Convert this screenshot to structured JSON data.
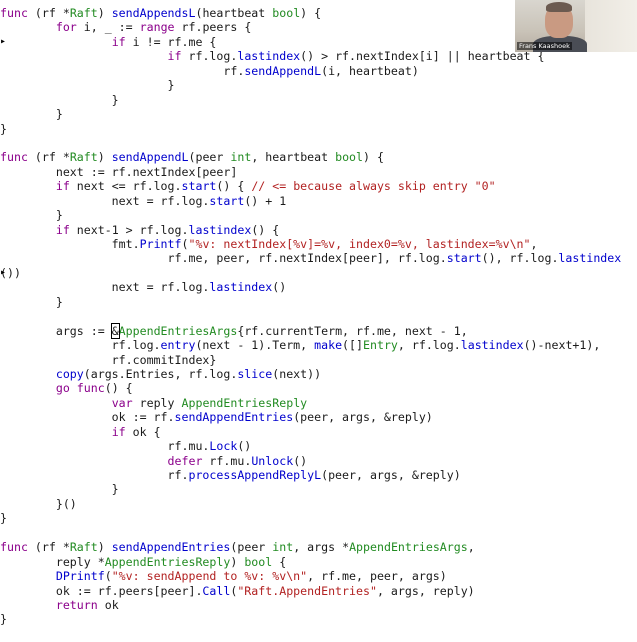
{
  "webcam": {
    "participant_name": "Frans Kaashoek"
  },
  "code_lines": [
    [
      [
        "kw",
        "func"
      ],
      [
        "id",
        " (rf *"
      ],
      [
        "ty",
        "Raft"
      ],
      [
        "id",
        ") "
      ],
      [
        "fn",
        "sendAppendsL"
      ],
      [
        "id",
        "(heartbeat "
      ],
      [
        "ty",
        "bool"
      ],
      [
        "id",
        ") {"
      ]
    ],
    [
      [
        "id",
        "        "
      ],
      [
        "kw",
        "for"
      ],
      [
        "id",
        " i, _ := "
      ],
      [
        "kw",
        "range"
      ],
      [
        "id",
        " rf.peers {"
      ]
    ],
    [
      [
        "id",
        "                "
      ],
      [
        "kw",
        "if"
      ],
      [
        "id",
        " i != rf.me {"
      ]
    ],
    [
      [
        "id",
        "                        "
      ],
      [
        "kw",
        "if"
      ],
      [
        "id",
        " rf.log."
      ],
      [
        "fn",
        "lastindex"
      ],
      [
        "id",
        "() > rf.nextIndex[i] || heartbeat {"
      ]
    ],
    [
      [
        "id",
        "                                rf."
      ],
      [
        "fn",
        "sendAppendL"
      ],
      [
        "id",
        "(i, heartbeat)"
      ]
    ],
    [
      [
        "id",
        "                        }"
      ]
    ],
    [
      [
        "id",
        "                }"
      ]
    ],
    [
      [
        "id",
        "        }"
      ]
    ],
    [
      [
        "id",
        "}"
      ]
    ],
    [
      [
        "id",
        ""
      ]
    ],
    [
      [
        "kw",
        "func"
      ],
      [
        "id",
        " (rf *"
      ],
      [
        "ty",
        "Raft"
      ],
      [
        "id",
        ") "
      ],
      [
        "fn",
        "sendAppendL"
      ],
      [
        "id",
        "(peer "
      ],
      [
        "ty",
        "int"
      ],
      [
        "id",
        ", heartbeat "
      ],
      [
        "ty",
        "bool"
      ],
      [
        "id",
        ") {"
      ]
    ],
    [
      [
        "id",
        "        next := rf.nextIndex[peer]"
      ]
    ],
    [
      [
        "id",
        "        "
      ],
      [
        "kw",
        "if"
      ],
      [
        "id",
        " next <= rf.log."
      ],
      [
        "fn",
        "start"
      ],
      [
        "id",
        "() { "
      ],
      [
        "cm",
        "// <= because always skip entry \"0\""
      ]
    ],
    [
      [
        "id",
        "                next = rf.log."
      ],
      [
        "fn",
        "start"
      ],
      [
        "id",
        "() + 1"
      ]
    ],
    [
      [
        "id",
        "        }"
      ]
    ],
    [
      [
        "id",
        "        "
      ],
      [
        "kw",
        "if"
      ],
      [
        "id",
        " next-1 > rf.log."
      ],
      [
        "fn",
        "lastindex"
      ],
      [
        "id",
        "() {"
      ]
    ],
    [
      [
        "id",
        "                fmt."
      ],
      [
        "fn",
        "Printf"
      ],
      [
        "id",
        "("
      ],
      [
        "st",
        "\"%v: nextIndex[%v]=%v, index0=%v, lastindex=%v\\n\""
      ],
      [
        "id",
        ","
      ]
    ],
    [
      [
        "id",
        "                        rf.me, peer, rf.nextIndex[peer], rf.log."
      ],
      [
        "fn",
        "start"
      ],
      [
        "id",
        "(), rf.log."
      ],
      [
        "fn",
        "lastindex"
      ]
    ],
    [
      [
        "id",
        "())"
      ]
    ],
    [
      [
        "id",
        "                next = rf.log."
      ],
      [
        "fn",
        "lastindex"
      ],
      [
        "id",
        "()"
      ]
    ],
    [
      [
        "id",
        "        }"
      ]
    ],
    [
      [
        "id",
        ""
      ]
    ],
    [
      [
        "id",
        "        args := "
      ],
      [
        "cur",
        "&"
      ],
      [
        "ty",
        "AppendEntriesArgs"
      ],
      [
        "id",
        "{rf.currentTerm, rf.me, next - 1,"
      ]
    ],
    [
      [
        "id",
        "                rf.log."
      ],
      [
        "fn",
        "entry"
      ],
      [
        "id",
        "(next - 1).Term, "
      ],
      [
        "fn",
        "make"
      ],
      [
        "id",
        "([]"
      ],
      [
        "ty",
        "Entry"
      ],
      [
        "id",
        ", rf.log."
      ],
      [
        "fn",
        "lastindex"
      ],
      [
        "id",
        "()-next+1),"
      ]
    ],
    [
      [
        "id",
        "                rf.commitIndex}"
      ]
    ],
    [
      [
        "id",
        "        "
      ],
      [
        "fn",
        "copy"
      ],
      [
        "id",
        "(args.Entries, rf.log."
      ],
      [
        "fn",
        "slice"
      ],
      [
        "id",
        "(next))"
      ]
    ],
    [
      [
        "id",
        "        "
      ],
      [
        "kw",
        "go"
      ],
      [
        "id",
        " "
      ],
      [
        "kw",
        "func"
      ],
      [
        "id",
        "() {"
      ]
    ],
    [
      [
        "id",
        "                "
      ],
      [
        "kw",
        "var"
      ],
      [
        "id",
        " reply "
      ],
      [
        "ty",
        "AppendEntriesReply"
      ]
    ],
    [
      [
        "id",
        "                ok := rf."
      ],
      [
        "fn",
        "sendAppendEntries"
      ],
      [
        "id",
        "(peer, args, &reply)"
      ]
    ],
    [
      [
        "id",
        "                "
      ],
      [
        "kw",
        "if"
      ],
      [
        "id",
        " ok {"
      ]
    ],
    [
      [
        "id",
        "                        rf.mu."
      ],
      [
        "fn",
        "Lock"
      ],
      [
        "id",
        "()"
      ]
    ],
    [
      [
        "id",
        "                        "
      ],
      [
        "kw",
        "defer"
      ],
      [
        "id",
        " rf.mu."
      ],
      [
        "fn",
        "Unlock"
      ],
      [
        "id",
        "()"
      ]
    ],
    [
      [
        "id",
        "                        rf."
      ],
      [
        "fn",
        "processAppendReplyL"
      ],
      [
        "id",
        "(peer, args, &reply)"
      ]
    ],
    [
      [
        "id",
        "                }"
      ]
    ],
    [
      [
        "id",
        "        }()"
      ]
    ],
    [
      [
        "id",
        "}"
      ]
    ],
    [
      [
        "id",
        ""
      ]
    ],
    [
      [
        "kw",
        "func"
      ],
      [
        "id",
        " (rf *"
      ],
      [
        "ty",
        "Raft"
      ],
      [
        "id",
        ") "
      ],
      [
        "fn",
        "sendAppendEntries"
      ],
      [
        "id",
        "(peer "
      ],
      [
        "ty",
        "int"
      ],
      [
        "id",
        ", args *"
      ],
      [
        "ty",
        "AppendEntriesArgs"
      ],
      [
        "id",
        ","
      ]
    ],
    [
      [
        "id",
        "        reply *"
      ],
      [
        "ty",
        "AppendEntriesReply"
      ],
      [
        "id",
        ") "
      ],
      [
        "ty",
        "bool"
      ],
      [
        "id",
        " {"
      ]
    ],
    [
      [
        "id",
        "        "
      ],
      [
        "fn",
        "DPrintf"
      ],
      [
        "id",
        "("
      ],
      [
        "st",
        "\"%v: sendAppend to %v: %v\\n\""
      ],
      [
        "id",
        ", rf.me, peer, args)"
      ]
    ],
    [
      [
        "id",
        "        ok := rf.peers[peer]."
      ],
      [
        "fn",
        "Call"
      ],
      [
        "id",
        "("
      ],
      [
        "st",
        "\"Raft.AppendEntries\""
      ],
      [
        "id",
        ", args, reply)"
      ]
    ],
    [
      [
        "id",
        "        "
      ],
      [
        "kw",
        "return"
      ],
      [
        "id",
        " ok"
      ]
    ],
    [
      [
        "id",
        "}"
      ]
    ]
  ],
  "colors": {
    "keyword": "#8b008b",
    "type": "#228b22",
    "function": "#0000cd",
    "string_comment": "#b22222",
    "text": "#1a1a1a",
    "background": "#ffffff"
  }
}
